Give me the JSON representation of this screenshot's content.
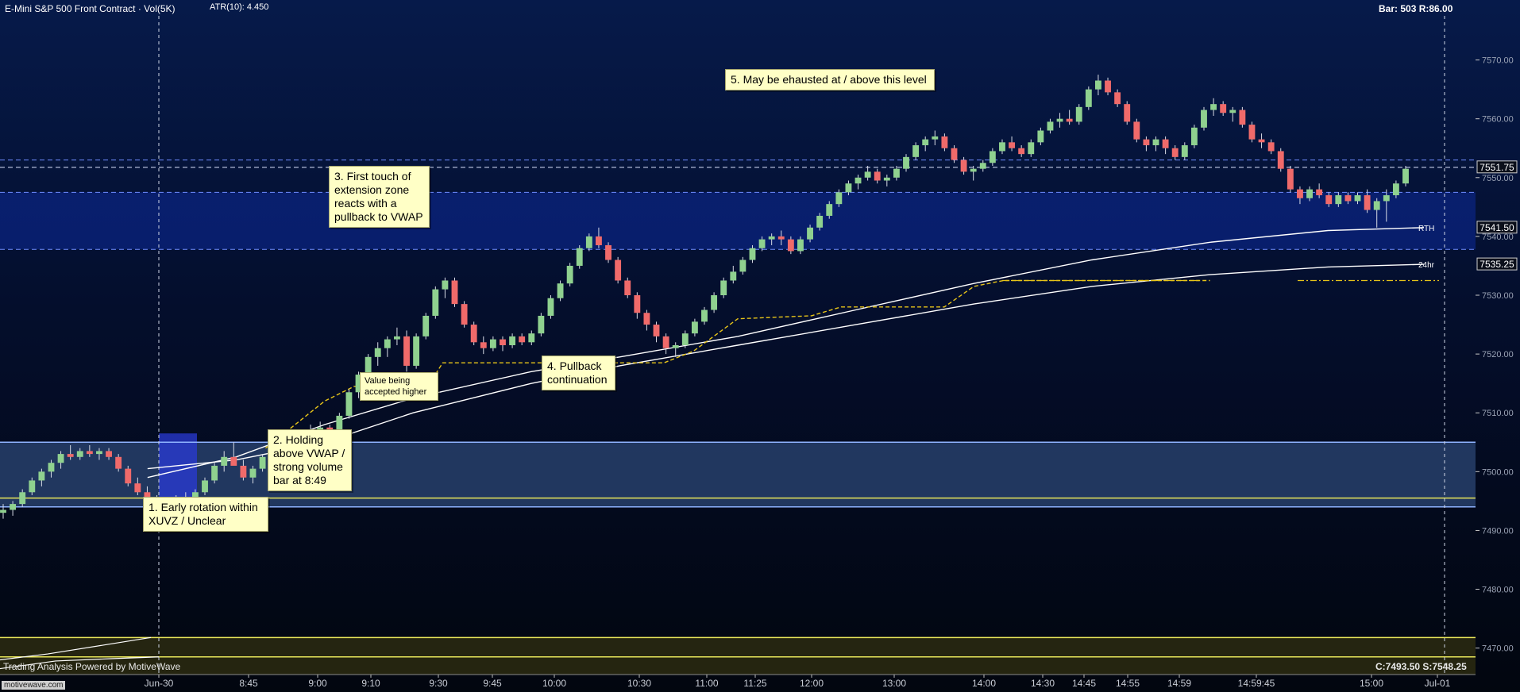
{
  "header": {
    "title": "E-Mini S&P 500 Front Contract · Vol(5K)",
    "atr": "ATR(10): 4.450",
    "bar_info": "Bar: 503  R:86.00"
  },
  "footer": {
    "left": "Trading Analysis Powered by MotiveWave",
    "right": "C:7493.50  S:7548.25",
    "logo": "motivewave.com"
  },
  "colors": {
    "background_top": "#061a4a",
    "background_bottom": "#02060f",
    "candle_up": "#8fd18f",
    "candle_down": "#f06a6a",
    "vwap": "#ffffff",
    "value_line": "#e6c419",
    "zone_band": "#2f4a7a",
    "zone_line": "#8fb3ff",
    "yellow_line": "#e8e65a"
  },
  "price_labels": [
    {
      "text": "7551.75",
      "price": 7551.75,
      "style": "dark"
    },
    {
      "text": "7541.50",
      "price": 7541.5,
      "style": "dark"
    },
    {
      "text": "7535.25",
      "price": 7535.25,
      "style": "dark"
    }
  ],
  "line_labels": [
    {
      "text": "RTH",
      "price": 7541.5
    },
    {
      "text": "24hr",
      "price": 7535.25
    }
  ],
  "annotations": [
    {
      "id": "note-1",
      "text": "1. Early rotation within\nXUVZ / Unclear"
    },
    {
      "id": "note-2",
      "text": "2. Holding\nabove VWAP /\nstrong volume\nbar at 8:49"
    },
    {
      "id": "note-3",
      "text": "3. First touch of\nextension zone\nreacts with a\npullback to VWAP"
    },
    {
      "id": "note-4",
      "text": "4. Pullback\ncontinuation"
    },
    {
      "id": "note-5",
      "text": "5. May be ehausted at / above this level"
    },
    {
      "id": "note-6",
      "text": "Value being\naccepted higher"
    }
  ],
  "chart_data": {
    "type": "candlestick",
    "y_axis": {
      "ticks": [
        7470,
        7480,
        7490,
        7500,
        7510,
        7520,
        7530,
        7540,
        7550,
        7560,
        7570
      ],
      "tick_labels": [
        "7470.00",
        "7480.00",
        "7490.00",
        "7500.00",
        "7510.00",
        "7520.00",
        "7530.00",
        "7540.00",
        "7550.00",
        "7560.00",
        "7570.00"
      ],
      "range": [
        7465.5,
        7577.5
      ],
      "position": "right"
    },
    "x_axis": {
      "tick_labels": [
        "Jun-30",
        "8:45",
        "9:00",
        "9:10",
        "9:30",
        "9:45",
        "10:00",
        "10:30",
        "11:00",
        "11:25",
        "12:00",
        "13:00",
        "14:00",
        "14:30",
        "14:45",
        "14:55",
        "14:59",
        "14:59:45",
        "15:00",
        "Jul-01"
      ]
    },
    "grid": false,
    "horizontal_levels": [
      {
        "name": "zone_top",
        "price": 7505.0,
        "style": "blue-solid"
      },
      {
        "name": "zone_bottom",
        "price": 7494.0,
        "style": "blue-solid"
      },
      {
        "name": "zone_mid",
        "price": 7495.5,
        "style": "yellow-solid"
      },
      {
        "name": "ext_1",
        "price": 7553.0,
        "style": "blue-dashed"
      },
      {
        "name": "ext_2",
        "price": 7551.75,
        "style": "white-dashed"
      },
      {
        "name": "ext_3",
        "price": 7547.5,
        "style": "blue-dashed"
      },
      {
        "name": "ext_4",
        "price": 7537.8,
        "style": "blue-dashed"
      },
      {
        "name": "low_zone_top",
        "price": 7471.8,
        "style": "yellow-solid"
      },
      {
        "name": "low_zone_bottom",
        "price": 7468.5,
        "style": "yellow-solid"
      }
    ],
    "candles": [
      [
        7493.0,
        7494.5,
        7492.0,
        7493.5
      ],
      [
        7493.5,
        7495.0,
        7492.5,
        7494.5
      ],
      [
        7494.5,
        7497.0,
        7494.0,
        7496.5
      ],
      [
        7496.5,
        7499.0,
        7496.0,
        7498.5
      ],
      [
        7498.5,
        7500.5,
        7497.5,
        7500.0
      ],
      [
        7500.0,
        7502.0,
        7499.0,
        7501.5
      ],
      [
        7501.5,
        7503.5,
        7500.5,
        7503.0
      ],
      [
        7503.0,
        7504.5,
        7502.0,
        7502.5
      ],
      [
        7502.5,
        7504.0,
        7502.0,
        7503.5
      ],
      [
        7503.5,
        7504.5,
        7502.5,
        7503.0
      ],
      [
        7503.0,
        7504.0,
        7502.0,
        7503.5
      ],
      [
        7503.5,
        7504.0,
        7502.0,
        7502.5
      ],
      [
        7502.5,
        7503.0,
        7500.0,
        7500.5
      ],
      [
        7500.5,
        7501.0,
        7497.5,
        7498.0
      ],
      [
        7498.0,
        7499.0,
        7496.0,
        7496.5
      ],
      [
        7496.5,
        7497.5,
        7494.5,
        7495.0
      ],
      [
        7495.0,
        7496.0,
        7492.0,
        7493.0
      ],
      [
        7493.0,
        7495.0,
        7492.5,
        7494.5
      ],
      [
        7494.5,
        7496.0,
        7493.5,
        7495.5
      ],
      [
        7495.5,
        7496.5,
        7494.5,
        7495.0
      ],
      [
        7495.0,
        7497.0,
        7494.5,
        7496.5
      ],
      [
        7496.5,
        7499.0,
        7496.0,
        7498.5
      ],
      [
        7498.5,
        7501.5,
        7498.0,
        7501.0
      ],
      [
        7501.0,
        7503.5,
        7500.0,
        7502.5
      ],
      [
        7502.5,
        7505.0,
        7501.5,
        7501.0
      ],
      [
        7501.0,
        7502.0,
        7498.5,
        7499.0
      ],
      [
        7499.0,
        7501.0,
        7498.0,
        7500.5
      ],
      [
        7500.5,
        7503.0,
        7500.0,
        7502.5
      ],
      [
        7502.5,
        7505.0,
        7502.0,
        7504.0
      ],
      [
        7504.0,
        7506.5,
        7503.0,
        7505.5
      ],
      [
        7505.5,
        7507.0,
        7504.0,
        7504.5
      ],
      [
        7504.5,
        7506.0,
        7503.5,
        7505.5
      ],
      [
        7505.5,
        7508.0,
        7505.0,
        7506.5
      ],
      [
        7506.5,
        7508.5,
        7505.5,
        7507.5
      ],
      [
        7507.5,
        7508.0,
        7505.0,
        7505.5
      ],
      [
        7505.5,
        7510.0,
        7505.0,
        7509.5
      ],
      [
        7509.5,
        7514.0,
        7509.0,
        7513.5
      ],
      [
        7513.5,
        7517.0,
        7512.5,
        7516.5
      ],
      [
        7516.5,
        7520.0,
        7515.5,
        7519.5
      ],
      [
        7519.5,
        7522.0,
        7518.0,
        7521.0
      ],
      [
        7521.0,
        7523.0,
        7519.5,
        7522.5
      ],
      [
        7522.5,
        7524.5,
        7521.5,
        7523.0
      ],
      [
        7523.0,
        7524.0,
        7517.0,
        7518.0
      ],
      [
        7518.0,
        7523.5,
        7517.5,
        7523.0
      ],
      [
        7523.0,
        7527.0,
        7522.5,
        7526.5
      ],
      [
        7526.5,
        7531.5,
        7526.0,
        7531.0
      ],
      [
        7531.0,
        7533.0,
        7529.5,
        7532.5
      ],
      [
        7532.5,
        7533.0,
        7528.0,
        7528.5
      ],
      [
        7528.5,
        7529.0,
        7524.5,
        7525.0
      ],
      [
        7525.0,
        7525.5,
        7521.5,
        7522.0
      ],
      [
        7522.0,
        7523.0,
        7520.0,
        7521.0
      ],
      [
        7521.0,
        7523.0,
        7520.5,
        7522.5
      ],
      [
        7522.5,
        7523.0,
        7520.5,
        7521.5
      ],
      [
        7521.5,
        7523.5,
        7521.0,
        7523.0
      ],
      [
        7523.0,
        7523.5,
        7521.5,
        7522.0
      ],
      [
        7522.0,
        7524.0,
        7521.5,
        7523.5
      ],
      [
        7523.5,
        7527.0,
        7523.0,
        7526.5
      ],
      [
        7526.5,
        7530.0,
        7526.0,
        7529.5
      ],
      [
        7529.5,
        7532.5,
        7529.0,
        7532.0
      ],
      [
        7532.0,
        7535.5,
        7531.5,
        7535.0
      ],
      [
        7535.0,
        7538.5,
        7534.5,
        7538.0
      ],
      [
        7538.0,
        7540.5,
        7537.5,
        7540.0
      ],
      [
        7540.0,
        7541.5,
        7538.0,
        7538.5
      ],
      [
        7538.5,
        7539.0,
        7535.5,
        7536.0
      ],
      [
        7536.0,
        7536.5,
        7532.0,
        7532.5
      ],
      [
        7532.5,
        7533.0,
        7529.5,
        7530.0
      ],
      [
        7530.0,
        7530.5,
        7526.0,
        7527.0
      ],
      [
        7527.0,
        7527.5,
        7524.0,
        7525.0
      ],
      [
        7525.0,
        7525.5,
        7522.0,
        7523.0
      ],
      [
        7523.0,
        7523.5,
        7520.0,
        7521.0
      ],
      [
        7521.0,
        7522.0,
        7519.5,
        7521.5
      ],
      [
        7521.5,
        7524.0,
        7521.0,
        7523.5
      ],
      [
        7523.5,
        7526.0,
        7523.0,
        7525.5
      ],
      [
        7525.5,
        7528.0,
        7525.0,
        7527.5
      ],
      [
        7527.5,
        7530.5,
        7527.0,
        7530.0
      ],
      [
        7530.0,
        7533.0,
        7529.5,
        7532.5
      ],
      [
        7532.5,
        7535.0,
        7532.0,
        7534.0
      ],
      [
        7534.0,
        7536.5,
        7533.5,
        7536.0
      ],
      [
        7536.0,
        7538.5,
        7535.5,
        7538.0
      ],
      [
        7538.0,
        7540.0,
        7537.5,
        7539.5
      ],
      [
        7539.5,
        7540.5,
        7538.5,
        7540.0
      ],
      [
        7540.0,
        7541.0,
        7538.5,
        7539.5
      ],
      [
        7539.5,
        7540.0,
        7537.0,
        7537.5
      ],
      [
        7537.5,
        7540.0,
        7537.0,
        7539.5
      ],
      [
        7539.5,
        7542.0,
        7539.0,
        7541.5
      ],
      [
        7541.5,
        7544.0,
        7541.0,
        7543.5
      ],
      [
        7543.5,
        7546.0,
        7543.0,
        7545.5
      ],
      [
        7545.5,
        7548.0,
        7545.0,
        7547.5
      ],
      [
        7547.5,
        7549.5,
        7547.0,
        7549.0
      ],
      [
        7549.0,
        7550.5,
        7548.0,
        7550.0
      ],
      [
        7550.0,
        7552.0,
        7549.5,
        7551.0
      ],
      [
        7551.0,
        7551.5,
        7549.0,
        7549.5
      ],
      [
        7549.5,
        7550.5,
        7548.5,
        7550.0
      ],
      [
        7550.0,
        7552.0,
        7549.5,
        7551.5
      ],
      [
        7551.5,
        7554.0,
        7551.0,
        7553.5
      ],
      [
        7553.5,
        7556.0,
        7553.0,
        7555.5
      ],
      [
        7555.5,
        7557.0,
        7554.5,
        7556.5
      ],
      [
        7556.5,
        7558.0,
        7555.5,
        7557.0
      ],
      [
        7557.0,
        7557.5,
        7554.5,
        7555.0
      ],
      [
        7555.0,
        7555.5,
        7552.5,
        7553.0
      ],
      [
        7553.0,
        7553.5,
        7550.5,
        7551.0
      ],
      [
        7551.0,
        7552.0,
        7549.5,
        7551.5
      ],
      [
        7551.5,
        7553.0,
        7551.0,
        7552.5
      ],
      [
        7552.5,
        7555.0,
        7552.0,
        7554.5
      ],
      [
        7554.5,
        7556.5,
        7554.0,
        7556.0
      ],
      [
        7556.0,
        7557.0,
        7554.5,
        7555.0
      ],
      [
        7555.0,
        7555.5,
        7553.5,
        7554.0
      ],
      [
        7554.0,
        7556.5,
        7553.5,
        7556.0
      ],
      [
        7556.0,
        7558.5,
        7555.5,
        7558.0
      ],
      [
        7558.0,
        7560.0,
        7557.5,
        7559.5
      ],
      [
        7559.5,
        7561.0,
        7558.5,
        7560.0
      ],
      [
        7560.0,
        7561.5,
        7559.0,
        7559.5
      ],
      [
        7559.5,
        7562.5,
        7559.0,
        7562.0
      ],
      [
        7562.0,
        7565.5,
        7561.5,
        7565.0
      ],
      [
        7565.0,
        7567.5,
        7564.0,
        7566.5
      ],
      [
        7566.5,
        7567.0,
        7564.0,
        7564.5
      ],
      [
        7564.5,
        7565.0,
        7562.0,
        7562.5
      ],
      [
        7562.5,
        7563.0,
        7559.0,
        7559.5
      ],
      [
        7559.5,
        7560.0,
        7556.0,
        7556.5
      ],
      [
        7556.5,
        7557.0,
        7554.5,
        7555.5
      ],
      [
        7555.5,
        7557.0,
        7554.5,
        7556.5
      ],
      [
        7556.5,
        7557.0,
        7554.0,
        7555.0
      ],
      [
        7555.0,
        7555.5,
        7553.0,
        7553.5
      ],
      [
        7553.5,
        7556.0,
        7553.0,
        7555.5
      ],
      [
        7555.5,
        7559.0,
        7555.0,
        7558.5
      ],
      [
        7558.5,
        7562.0,
        7558.0,
        7561.5
      ],
      [
        7561.5,
        7563.5,
        7560.5,
        7562.5
      ],
      [
        7562.5,
        7563.0,
        7560.5,
        7561.0
      ],
      [
        7561.0,
        7562.0,
        7559.5,
        7561.5
      ],
      [
        7561.5,
        7562.0,
        7558.5,
        7559.0
      ],
      [
        7559.0,
        7559.5,
        7556.0,
        7556.5
      ],
      [
        7556.5,
        7557.5,
        7555.0,
        7556.0
      ],
      [
        7556.0,
        7556.5,
        7554.0,
        7554.5
      ],
      [
        7554.5,
        7555.0,
        7551.0,
        7551.5
      ],
      [
        7551.5,
        7552.0,
        7547.5,
        7548.0
      ],
      [
        7548.0,
        7548.5,
        7545.5,
        7546.5
      ],
      [
        7546.5,
        7548.5,
        7546.0,
        7548.0
      ],
      [
        7548.0,
        7549.0,
        7546.5,
        7547.0
      ],
      [
        7547.0,
        7547.5,
        7545.0,
        7545.5
      ],
      [
        7545.5,
        7547.5,
        7545.0,
        7547.0
      ],
      [
        7547.0,
        7547.5,
        7545.5,
        7546.0
      ],
      [
        7546.0,
        7547.5,
        7545.5,
        7547.0
      ],
      [
        7547.0,
        7548.0,
        7544.0,
        7544.5
      ],
      [
        7544.5,
        7546.5,
        7541.5,
        7546.0
      ],
      [
        7546.0,
        7548.0,
        7542.5,
        7547.0
      ],
      [
        7547.0,
        7549.5,
        7546.5,
        7549.0
      ],
      [
        7549.0,
        7552.0,
        7548.5,
        7551.5
      ]
    ],
    "overlays": [
      {
        "name": "VWAP RTH",
        "color": "#ffffff",
        "points": [
          [
            0.1,
            7499.0
          ],
          [
            0.16,
            7502.5
          ],
          [
            0.22,
            7508.0
          ],
          [
            0.28,
            7512.5
          ],
          [
            0.36,
            7517.0
          ],
          [
            0.42,
            7519.5
          ],
          [
            0.5,
            7523.0
          ],
          [
            0.58,
            7527.5
          ],
          [
            0.66,
            7532.0
          ],
          [
            0.74,
            7536.0
          ],
          [
            0.82,
            7539.0
          ],
          [
            0.9,
            7541.0
          ],
          [
            0.965,
            7541.5
          ]
        ]
      },
      {
        "name": "VWAP 24hr",
        "color": "#ffffff",
        "points": [
          [
            0.1,
            7500.5
          ],
          [
            0.16,
            7502.0
          ],
          [
            0.22,
            7505.0
          ],
          [
            0.28,
            7510.0
          ],
          [
            0.36,
            7515.0
          ],
          [
            0.42,
            7518.0
          ],
          [
            0.5,
            7521.5
          ],
          [
            0.58,
            7525.0
          ],
          [
            0.66,
            7528.5
          ],
          [
            0.74,
            7531.5
          ],
          [
            0.82,
            7533.5
          ],
          [
            0.9,
            7534.8
          ],
          [
            0.965,
            7535.25
          ]
        ]
      },
      {
        "name": "Value Area",
        "color": "#e6c419",
        "points": [
          [
            0.18,
            7504.0
          ],
          [
            0.22,
            7512.0
          ],
          [
            0.24,
            7514.5
          ],
          [
            0.29,
            7514.5
          ],
          [
            0.3,
            7518.5
          ],
          [
            0.45,
            7518.5
          ],
          [
            0.47,
            7520.5
          ],
          [
            0.5,
            7526.0
          ],
          [
            0.55,
            7526.5
          ],
          [
            0.57,
            7528.0
          ],
          [
            0.64,
            7528.0
          ],
          [
            0.66,
            7531.5
          ],
          [
            0.68,
            7532.5
          ],
          [
            0.82,
            7532.5
          ]
        ]
      }
    ]
  }
}
